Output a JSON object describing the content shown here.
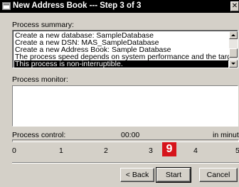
{
  "window": {
    "title": "New Address Book --- Step 3 of 3"
  },
  "summary": {
    "label": "Process summary:",
    "items": [
      "Create a new database: SampleDatabase",
      "Create a new DSN: MAS_SampleDatabase",
      "Create a new Address Book: Sample Database",
      "The process speed depends on system performance and the target action type.",
      "This process is non-interruptible."
    ],
    "selected_index": 4
  },
  "monitor": {
    "label": "Process monitor:"
  },
  "control": {
    "label": "Process control:",
    "time": "00:00",
    "unit_label": "in minutes",
    "ticks": [
      "0",
      "1",
      "2",
      "3",
      "4",
      "5"
    ]
  },
  "badge": "9",
  "buttons": {
    "back": "< Back",
    "start": "Start",
    "cancel": "Cancel"
  },
  "colors": {
    "badge": "#d6141b",
    "selection": "#000000",
    "titlebar": "#000000"
  }
}
